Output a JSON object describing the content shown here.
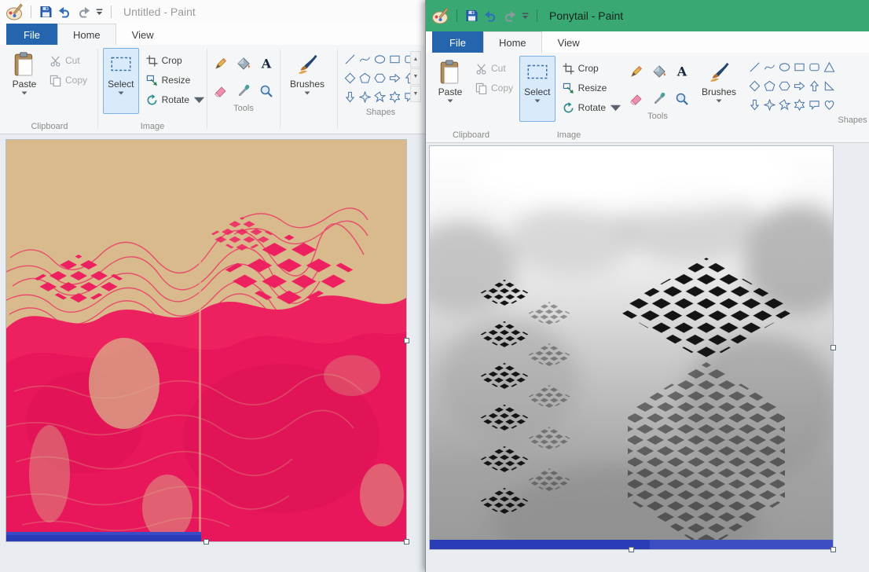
{
  "app": {
    "name": "Paint"
  },
  "colors": {
    "titlebar_active": "#3aa873",
    "file_tab_blue": "#2565ae",
    "ribbon_bg": "#f5f6f7",
    "select_highlight": "#d9eafb",
    "artwork_pink": "#ee2160",
    "artwork_tan": "#d9ba8c",
    "artwork_strip_blue": "#2b3db6"
  },
  "windows": {
    "left": {
      "title": "Untitled - Paint",
      "state": "inactive"
    },
    "right": {
      "title": "Ponytail - Paint",
      "state": "active"
    }
  },
  "quick_access": {
    "icons": [
      "paint-logo",
      "save",
      "undo",
      "redo",
      "customize-quick-access-menu"
    ]
  },
  "tabs": {
    "file": "File",
    "home": "Home",
    "view": "View"
  },
  "groups": {
    "clipboard": "Clipboard",
    "image": "Image",
    "tools": "Tools",
    "shapes": "Shapes"
  },
  "buttons": {
    "paste": "Paste",
    "cut": "Cut",
    "copy": "Copy",
    "select": "Select",
    "crop": "Crop",
    "resize": "Resize",
    "rotate": "Rotate",
    "brushes": "Brushes"
  },
  "disabled_buttons": [
    "cut",
    "copy"
  ],
  "tool_icons": [
    "pencil",
    "fill-with-color",
    "text",
    "eraser",
    "color-picker",
    "magnifier"
  ],
  "shape_icons": [
    "line",
    "curve",
    "oval",
    "rectangle",
    "rounded-rectangle",
    "triangle",
    "diamond",
    "pentagon",
    "hexagon",
    "arrow-right",
    "arrow-up",
    "right-triangle",
    "arrow-down",
    "star-4",
    "star-5",
    "star-6",
    "rounded-callout",
    "heart"
  ]
}
